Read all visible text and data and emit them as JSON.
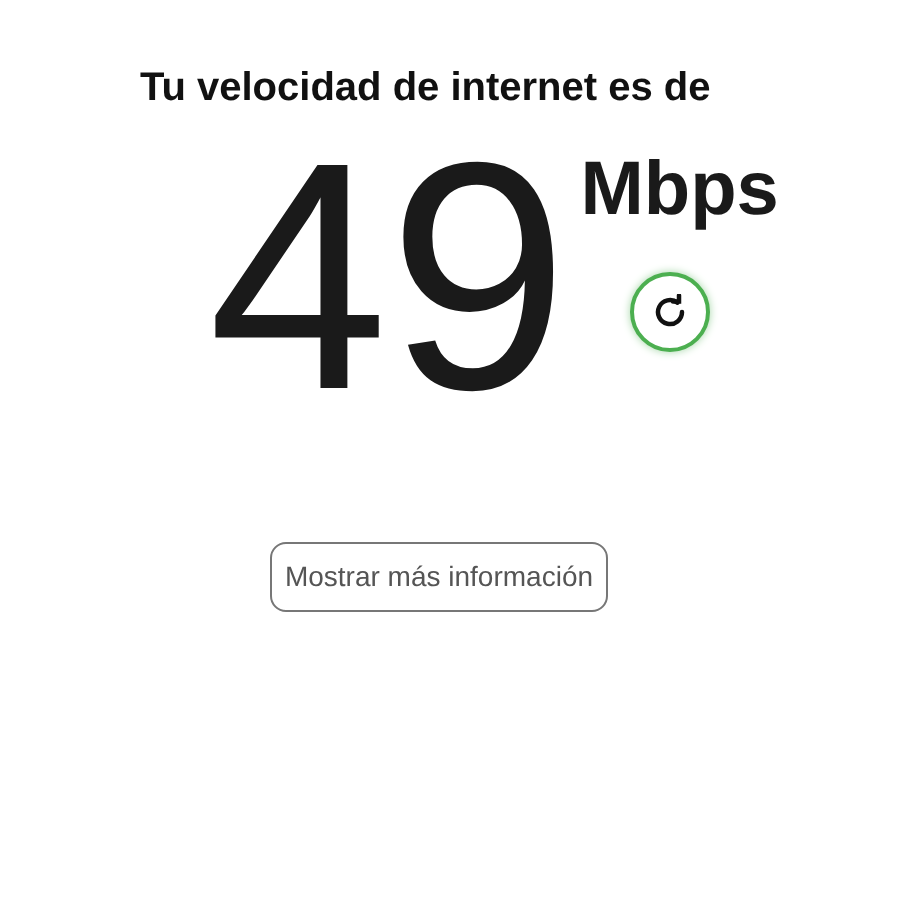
{
  "heading": "Tu velocidad de internet es de",
  "speed": {
    "value": "49",
    "unit": "Mbps"
  },
  "button": {
    "label": "Mostrar más información"
  }
}
